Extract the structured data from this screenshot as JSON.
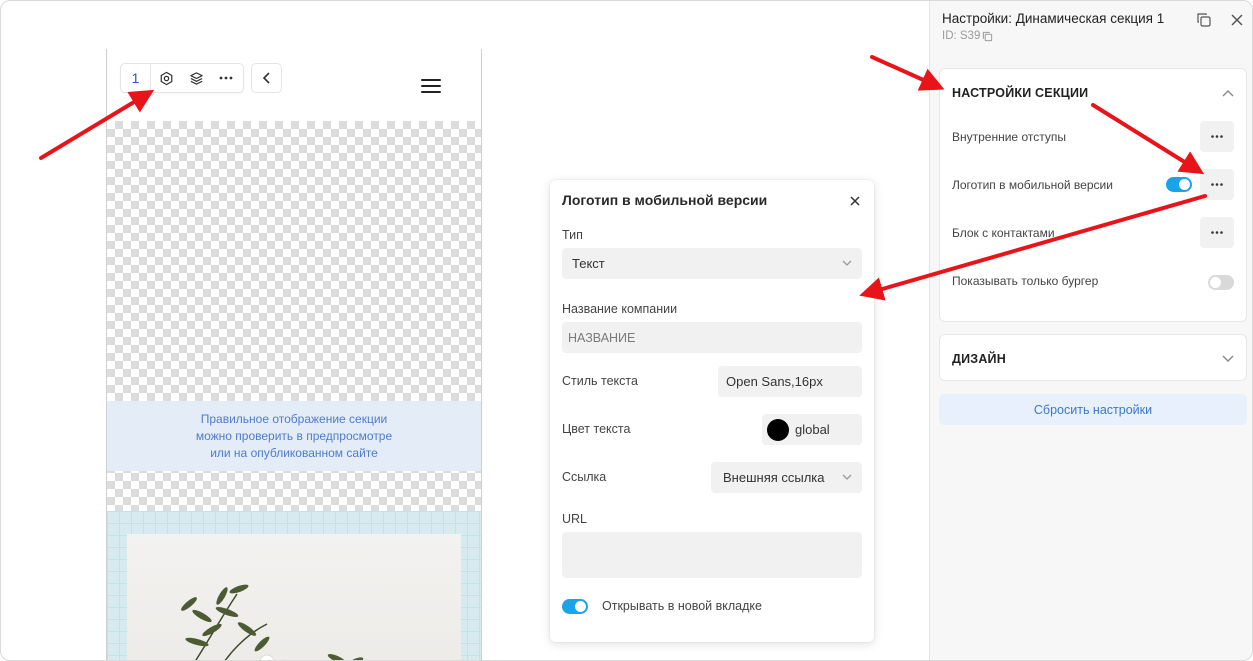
{
  "toolbar": {
    "section_number": "1",
    "icons": [
      "gear-icon",
      "layers-icon",
      "more-icon"
    ],
    "back_icon": "chevron-left-icon",
    "menu_icon": "burger-menu-icon"
  },
  "preview": {
    "notice_lines": [
      "Правильное отображение секции",
      "можно проверить в предпросмотре",
      "или на опубликованном сайте"
    ]
  },
  "popup": {
    "title": "Логотип в мобильной версии",
    "type_label": "Тип",
    "type_value": "Текст",
    "company_label": "Название компании",
    "company_value": "НАЗВАНИЕ",
    "text_style_label": "Стиль текста",
    "text_style_value": "Open Sans,16px",
    "text_color_label": "Цвет текста",
    "text_color_value": "global",
    "text_color_swatch": "#000000",
    "link_label": "Ссылка",
    "link_value": "Внешняя ссылка",
    "url_label": "URL",
    "url_value": "",
    "new_tab_label": "Открывать в новой вкладке",
    "new_tab_on": true
  },
  "panel": {
    "title": "Настройки: Динамическая секция 1",
    "id": "ID: S39",
    "section_settings": {
      "heading": "НАСТРОЙКИ СЕКЦИИ",
      "rows": [
        {
          "label": "Внутренние отступы",
          "control": "dots"
        },
        {
          "label": "Логотип в мобильной версии",
          "control": "toggle+dots",
          "toggle_on": true
        },
        {
          "label": "Блок с контактами",
          "control": "dots"
        },
        {
          "label": "Показывать только бургер",
          "control": "toggle",
          "toggle_on": false
        }
      ]
    },
    "design": {
      "heading": "ДИЗАЙН"
    },
    "reset_label": "Сбросить настройки"
  },
  "colors": {
    "accent": "#1aa3e8",
    "link_blue": "#3b78c9",
    "arrow_red": "#e8141a",
    "notice_text": "#4f7bd0"
  }
}
